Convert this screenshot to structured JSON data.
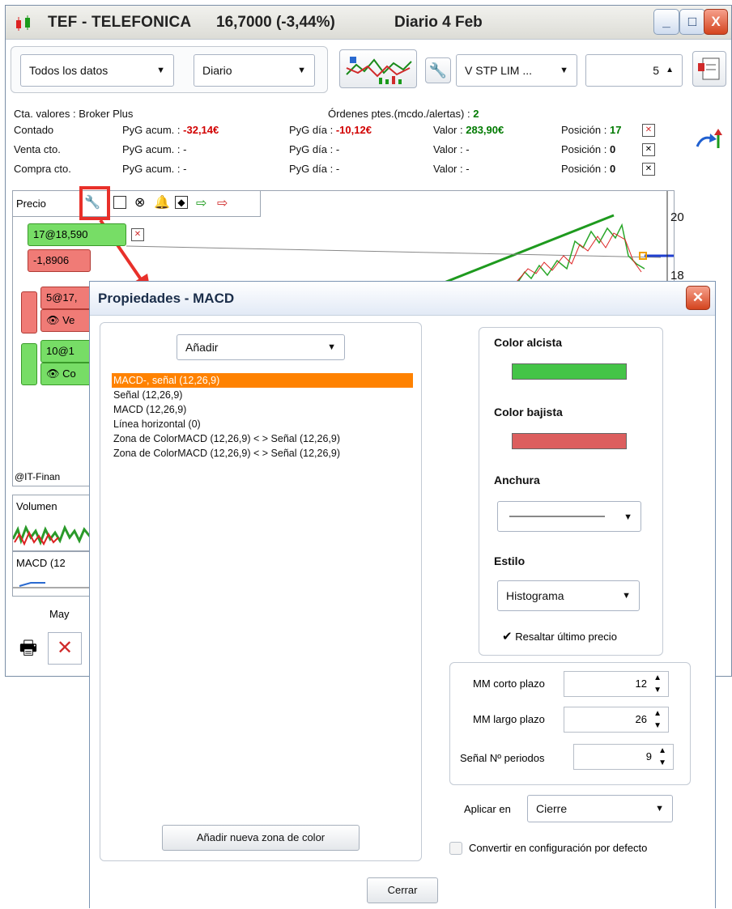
{
  "window": {
    "ticker": "TEF - TELEFONICA",
    "price": "16,7000 (-3,44%)",
    "period": "Diario  4 Feb",
    "minimize": "_",
    "maximize": "□",
    "close": "X"
  },
  "toolbar": {
    "range": "Todos los datos",
    "interval": "Diario",
    "order_type": "V STP LIM ...",
    "quantity": "5"
  },
  "account": {
    "broker": "Cta. valores : Broker Plus",
    "pending": "Órdenes ptes.(mcdo./alertas) :",
    "pending_count": "2",
    "rows": [
      {
        "name": "Contado",
        "pyg_acum_label": "PyG acum. :",
        "pyg_acum": "-32,14€",
        "pyg_dia_label": "PyG día :",
        "pyg_dia": "-10,12€",
        "valor_label": "Valor :",
        "valor": "283,90€",
        "pos_label": "Posición :",
        "pos": "17"
      },
      {
        "name": "Venta cto.",
        "pyg_acum_label": "PyG acum. :",
        "pyg_acum": "-",
        "pyg_dia_label": "PyG día :",
        "pyg_dia": "-",
        "valor_label": "Valor :",
        "valor": "-",
        "pos_label": "Posición :",
        "pos": "0"
      },
      {
        "name": "Compra cto.",
        "pyg_acum_label": "PyG acum. :",
        "pyg_acum": "-",
        "pyg_dia_label": "PyG día :",
        "pyg_dia": "-",
        "valor_label": "Valor :",
        "valor": "-",
        "pos_label": "Posición :",
        "pos": "0"
      }
    ]
  },
  "chart": {
    "panel_label": "Precio",
    "y_ticks": [
      "20",
      "18"
    ],
    "order_labels": [
      "17@18,590",
      "-1,8906",
      "5@17,",
      "Ve",
      "10@1",
      "Co"
    ],
    "copyright": "@IT-Finan",
    "volume_label": "Volumen",
    "macd_label": "MACD (12",
    "x_label": "May"
  },
  "dialog": {
    "title": "Propiedades - MACD",
    "add_dropdown": "Añadir",
    "items": [
      "MACD-, señal (12,26,9)",
      "Señal (12,26,9)",
      "MACD (12,26,9)",
      "Línea horizontal (0)",
      "Zona de ColorMACD (12,26,9) < > Señal (12,26,9)",
      "Zona de ColorMACD (12,26,9) < > Señal (12,26,9)"
    ],
    "add_zone_button": "Añadir nueva zona de color",
    "color_up_label": "Color alcista",
    "color_down_label": "Color bajista",
    "width_label": "Anchura",
    "style_label": "Estilo",
    "style_value": "Histograma",
    "highlight_label": "Resaltar último precio",
    "mm_short_label": "MM corto plazo",
    "mm_short_value": "12",
    "mm_long_label": "MM largo plazo",
    "mm_long_value": "26",
    "signal_label": "Señal Nº periodos",
    "signal_value": "9",
    "apply_label": "Aplicar en",
    "apply_value": "Cierre",
    "default_label": "Convertir en configuración por defecto",
    "close_button": "Cerrar"
  },
  "colors": {
    "up": "#44c447",
    "down": "#dc5e5e",
    "selected": "#ff8200",
    "highlight_box": "#e8302a"
  }
}
